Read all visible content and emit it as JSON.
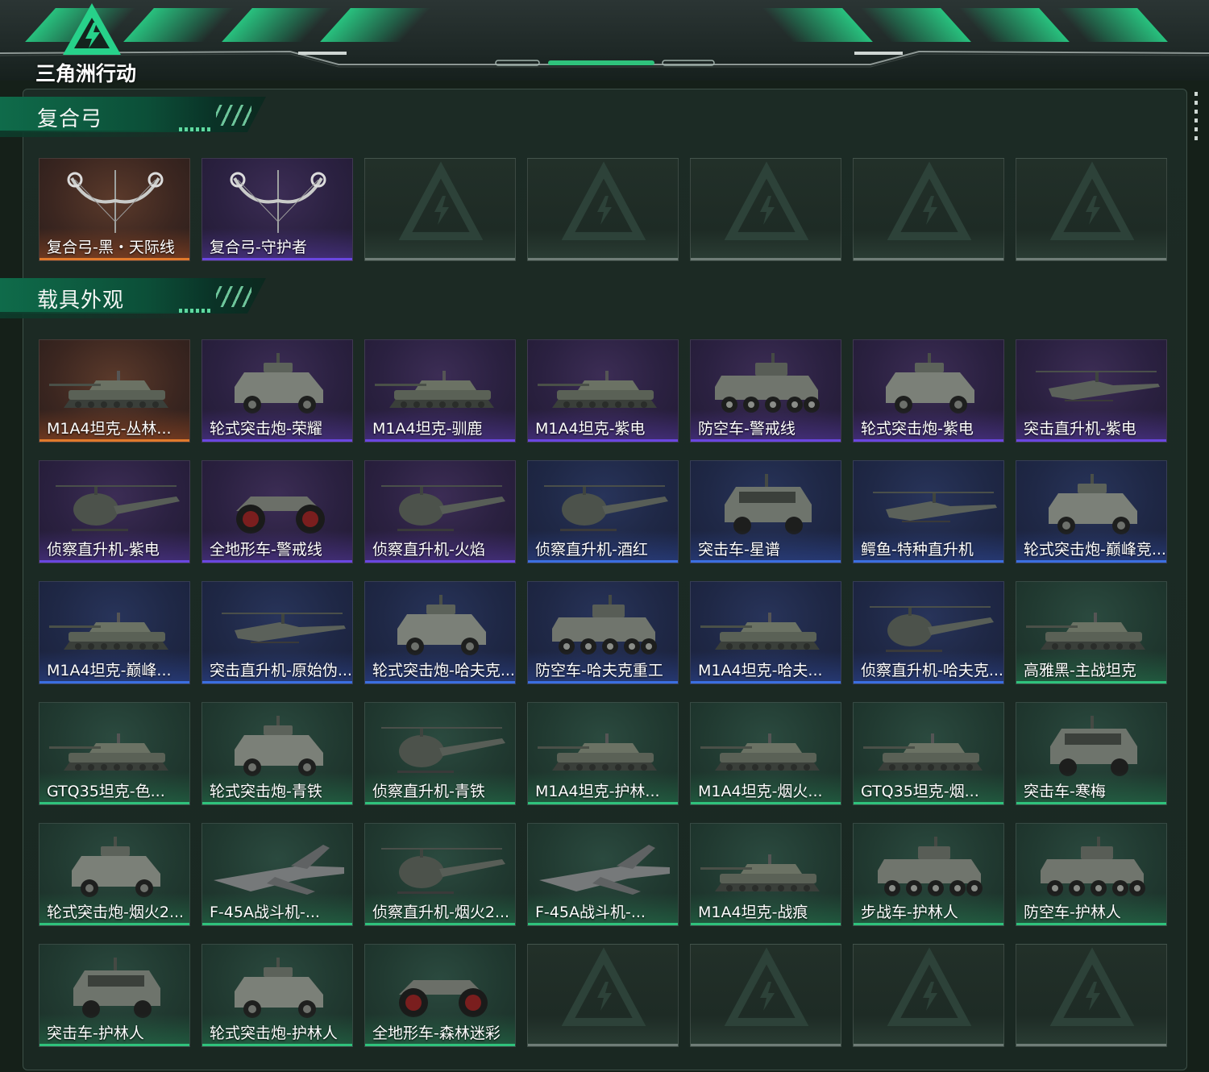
{
  "header": {
    "logo_text": "三角洲行动",
    "accent_color": "#2fc27c"
  },
  "sections": [
    {
      "title": "复合弓",
      "items": [
        {
          "label": "复合弓-黑・天际线",
          "rarity": "gold",
          "icon": "compound-bow-icon"
        },
        {
          "label": "复合弓-守护者",
          "rarity": "purple",
          "icon": "compound-bow-icon"
        },
        {
          "label": "",
          "rarity": "empty",
          "icon": "empty-slot-icon"
        },
        {
          "label": "",
          "rarity": "empty",
          "icon": "empty-slot-icon"
        },
        {
          "label": "",
          "rarity": "empty",
          "icon": "empty-slot-icon"
        },
        {
          "label": "",
          "rarity": "empty",
          "icon": "empty-slot-icon"
        },
        {
          "label": "",
          "rarity": "empty",
          "icon": "empty-slot-icon"
        }
      ]
    },
    {
      "title": "载具外观",
      "items": [
        {
          "label": "M1A4坦克-丛林...",
          "rarity": "gold",
          "icon": "tank-icon"
        },
        {
          "label": "轮式突击炮-荣耀",
          "rarity": "purple",
          "icon": "armored-car-icon"
        },
        {
          "label": "M1A4坦克-驯鹿",
          "rarity": "purple",
          "icon": "tank-icon"
        },
        {
          "label": "M1A4坦克-紫电",
          "rarity": "purple",
          "icon": "tank-icon"
        },
        {
          "label": "防空车-警戒线",
          "rarity": "purple",
          "icon": "apc-icon"
        },
        {
          "label": "轮式突击炮-紫电",
          "rarity": "purple",
          "icon": "armored-car-icon"
        },
        {
          "label": "突击直升机-紫电",
          "rarity": "purple",
          "icon": "attack-helicopter-icon"
        },
        {
          "label": "侦察直升机-紫电",
          "rarity": "purple",
          "icon": "scout-helicopter-icon"
        },
        {
          "label": "全地形车-警戒线",
          "rarity": "purple",
          "icon": "atv-icon"
        },
        {
          "label": "侦察直升机-火焰",
          "rarity": "purple",
          "icon": "scout-helicopter-icon"
        },
        {
          "label": "侦察直升机-酒红",
          "rarity": "blue",
          "icon": "scout-helicopter-icon"
        },
        {
          "label": "突击车-星谱",
          "rarity": "blue",
          "icon": "assault-vehicle-icon"
        },
        {
          "label": "鳄鱼-特种直升机",
          "rarity": "blue",
          "icon": "attack-helicopter-icon"
        },
        {
          "label": "轮式突击炮-巅峰竞...",
          "rarity": "blue",
          "icon": "armored-car-icon"
        },
        {
          "label": "M1A4坦克-巅峰...",
          "rarity": "blue",
          "icon": "tank-icon"
        },
        {
          "label": "突击直升机-原始伪...",
          "rarity": "blue",
          "icon": "attack-helicopter-icon"
        },
        {
          "label": "轮式突击炮-哈夫克...",
          "rarity": "blue",
          "icon": "armored-car-icon"
        },
        {
          "label": "防空车-哈夫克重工",
          "rarity": "blue",
          "icon": "apc-icon"
        },
        {
          "label": "M1A4坦克-哈夫...",
          "rarity": "blue",
          "icon": "tank-icon"
        },
        {
          "label": "侦察直升机-哈夫克...",
          "rarity": "blue",
          "icon": "scout-helicopter-icon"
        },
        {
          "label": "高雅黑-主战坦克",
          "rarity": "green",
          "icon": "tank-icon"
        },
        {
          "label": "GTQ35坦克-色...",
          "rarity": "green",
          "icon": "tank-icon"
        },
        {
          "label": "轮式突击炮-青铁",
          "rarity": "green",
          "icon": "armored-car-icon"
        },
        {
          "label": "侦察直升机-青铁",
          "rarity": "green",
          "icon": "scout-helicopter-icon"
        },
        {
          "label": "M1A4坦克-护林...",
          "rarity": "green",
          "icon": "tank-icon"
        },
        {
          "label": "M1A4坦克-烟火...",
          "rarity": "green",
          "icon": "tank-icon"
        },
        {
          "label": "GTQ35坦克-烟...",
          "rarity": "green",
          "icon": "tank-icon"
        },
        {
          "label": "突击车-寒梅",
          "rarity": "green",
          "icon": "assault-vehicle-icon"
        },
        {
          "label": "轮式突击炮-烟火2...",
          "rarity": "green",
          "icon": "armored-car-icon"
        },
        {
          "label": "F-45A战斗机-...",
          "rarity": "green",
          "icon": "fighter-jet-icon"
        },
        {
          "label": "侦察直升机-烟火2...",
          "rarity": "green",
          "icon": "scout-helicopter-icon"
        },
        {
          "label": "F-45A战斗机-...",
          "rarity": "green",
          "icon": "fighter-jet-icon"
        },
        {
          "label": "M1A4坦克-战痕",
          "rarity": "green",
          "icon": "tank-icon"
        },
        {
          "label": "步战车-护林人",
          "rarity": "green",
          "icon": "apc-icon"
        },
        {
          "label": "防空车-护林人",
          "rarity": "green",
          "icon": "apc-icon"
        },
        {
          "label": "突击车-护林人",
          "rarity": "green",
          "icon": "assault-vehicle-icon"
        },
        {
          "label": "轮式突击炮-护林人",
          "rarity": "green",
          "icon": "armored-car-icon"
        },
        {
          "label": "全地形车-森林迷彩",
          "rarity": "green",
          "icon": "atv-icon"
        },
        {
          "label": "",
          "rarity": "empty",
          "icon": "empty-slot-icon"
        },
        {
          "label": "",
          "rarity": "empty",
          "icon": "empty-slot-icon"
        },
        {
          "label": "",
          "rarity": "empty",
          "icon": "empty-slot-icon"
        },
        {
          "label": "",
          "rarity": "empty",
          "icon": "empty-slot-icon"
        }
      ]
    }
  ]
}
